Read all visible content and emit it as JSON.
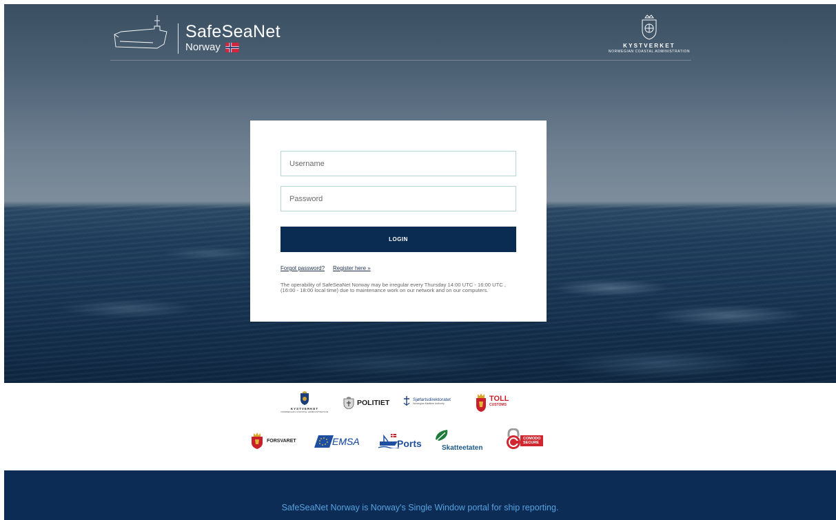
{
  "header": {
    "brand_title": "SafeSeaNet",
    "brand_subtitle": "Norway",
    "brand_logo_icon": "ship-outline-icon",
    "flag_icon": "norway-flag-icon",
    "authority_name": "KYSTVERKET",
    "authority_subtitle": "NORWEGIAN COASTAL ADMINISTRATION",
    "authority_icon": "coast-admin-crest-icon"
  },
  "login": {
    "username_placeholder": "Username",
    "password_placeholder": "Password",
    "login_label": "LOGIN",
    "forgot_password_label": "Forgot password?",
    "register_label": "Register here »",
    "notice": "The operability of SafeSeaNet Norway may be irregular every Thursday 14:00 UTC - 16:00 UTC , (16:00 - 18:00 local time) due to maintenance work on our network and on our computers."
  },
  "partners": {
    "kystverket_name": "KYSTVERKET",
    "kystverket_sub": "NORWEGIAN COASTAL ADMINISTRATION",
    "politiet": "POLITIET",
    "sjofart_name": "Sjøfartsdirektoratet",
    "sjofart_sub": "Norwegian Maritime Authority",
    "toll": "TOLL",
    "toll_sub": "CUSTOMS",
    "forsvaret": "FORSVARET",
    "emsa": "EMSA",
    "ports": "Ports",
    "skatteetaten": "Skatteetaten",
    "comodo": "COMODO",
    "comodo_sub": "SECURE"
  },
  "footer": {
    "text": "SafeSeaNet Norway is Norway's Single Window portal for ship reporting."
  },
  "colors": {
    "footer_bg": "#0d2c55",
    "login_button": "#0a2c52",
    "footer_text": "#55a2e0",
    "input_border": "#b6d6d2"
  }
}
